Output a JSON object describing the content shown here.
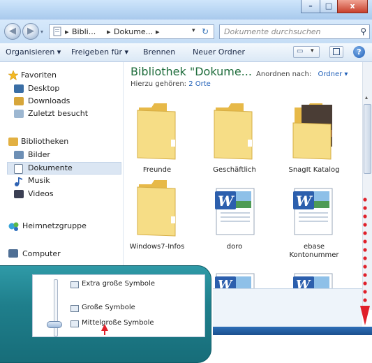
{
  "window": {
    "minimize_glyph": "–",
    "maximize_glyph": "□",
    "close_glyph": "x"
  },
  "address": {
    "crumbs": [
      "Bibli...",
      "Dokume..."
    ],
    "search_placeholder": "Dokumente durchsuchen"
  },
  "toolbar": {
    "organize": "Organisieren ▾",
    "share": "Freigeben für ▾",
    "burn": "Brennen",
    "new_folder": "Neuer Ordner",
    "help": "?"
  },
  "navpane": {
    "favorites": "Favoriten",
    "desktop": "Desktop",
    "downloads": "Downloads",
    "recent": "Zuletzt besucht",
    "libraries": "Bibliotheken",
    "pictures": "Bilder",
    "documents": "Dokumente",
    "music": "Musik",
    "videos": "Videos",
    "homegroup": "Heimnetzgruppe",
    "computer": "Computer"
  },
  "content": {
    "title": "Bibliothek \"Dokume...",
    "includes_prefix": "Hierzu gehören:",
    "includes_link": "2 Orte",
    "arrange_label": "Anordnen nach:",
    "arrange_value": "Ordner ▾",
    "items": [
      {
        "label": "Freunde"
      },
      {
        "label": "Geschäftlich"
      },
      {
        "label": "SnagIt Katalog"
      },
      {
        "label": "Windows7-Infos"
      },
      {
        "label": "doro"
      },
      {
        "label": "ebase Kontonummer"
      }
    ]
  },
  "view_menu": {
    "extra_large": "Extra große Symbole",
    "large": "Große Symbole",
    "medium": "Mittelgroße Symbole"
  },
  "colors": {
    "title_green": "#1e6c3b",
    "link_blue": "#1f5fb8",
    "annotation_red": "#e0202a"
  }
}
